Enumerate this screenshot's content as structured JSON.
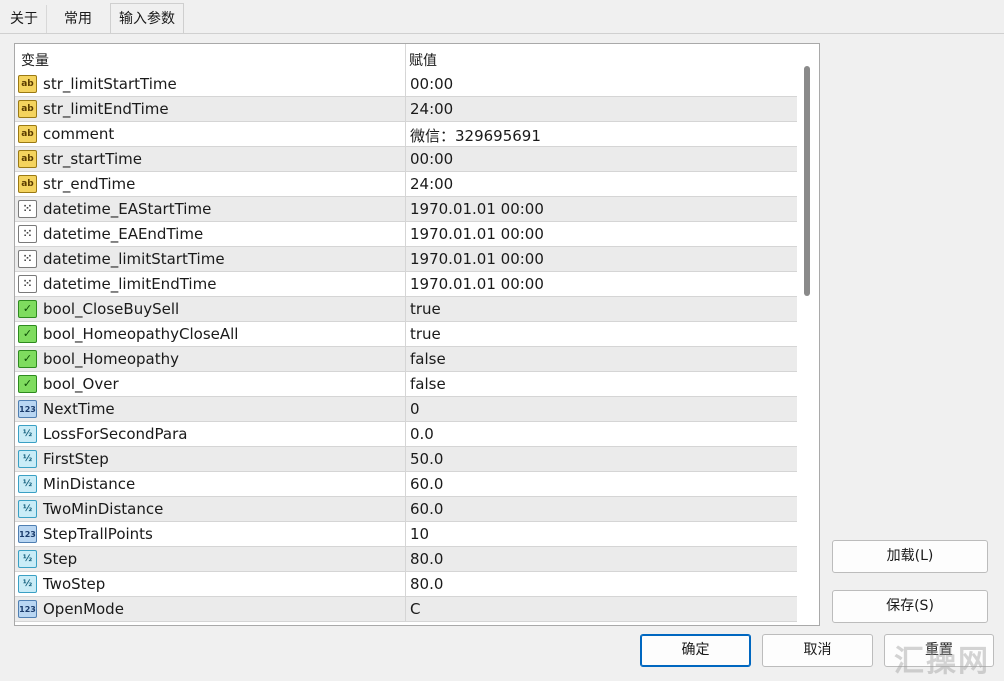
{
  "tabs": [
    {
      "label": "关于"
    },
    {
      "label": "常用"
    },
    {
      "label": "输入参数"
    }
  ],
  "grid": {
    "header": {
      "variable": "变量",
      "value": "赋值"
    },
    "rows": [
      {
        "icon": "string-icon",
        "name": "str_limitStartTime",
        "value": "00:00"
      },
      {
        "icon": "string-icon",
        "name": "str_limitEndTime",
        "value": "24:00"
      },
      {
        "icon": "string-icon",
        "name": "comment",
        "value": "微信：329695691"
      },
      {
        "icon": "string-icon",
        "name": "str_startTime",
        "value": "00:00"
      },
      {
        "icon": "string-icon",
        "name": "str_endTime",
        "value": "24:00"
      },
      {
        "icon": "datetime-icon",
        "name": "datetime_EAStartTime",
        "value": "1970.01.01 00:00"
      },
      {
        "icon": "datetime-icon",
        "name": "datetime_EAEndTime",
        "value": "1970.01.01 00:00"
      },
      {
        "icon": "datetime-icon",
        "name": "datetime_limitStartTime",
        "value": "1970.01.01 00:00"
      },
      {
        "icon": "datetime-icon",
        "name": "datetime_limitEndTime",
        "value": "1970.01.01 00:00"
      },
      {
        "icon": "bool-icon",
        "name": "bool_CloseBuySell",
        "value": "true"
      },
      {
        "icon": "bool-icon",
        "name": "bool_HomeopathyCloseAll",
        "value": "true"
      },
      {
        "icon": "bool-icon",
        "name": "bool_Homeopathy",
        "value": "false"
      },
      {
        "icon": "bool-icon",
        "name": "bool_Over",
        "value": "false"
      },
      {
        "icon": "int-icon",
        "name": "NextTime",
        "value": "0"
      },
      {
        "icon": "double-icon",
        "name": "LossForSecondPara",
        "value": "0.0"
      },
      {
        "icon": "double-icon",
        "name": "FirstStep",
        "value": "50.0"
      },
      {
        "icon": "double-icon",
        "name": "MinDistance",
        "value": "60.0"
      },
      {
        "icon": "double-icon",
        "name": "TwoMinDistance",
        "value": "60.0"
      },
      {
        "icon": "int-icon",
        "name": "StepTrallPoints",
        "value": "10"
      },
      {
        "icon": "double-icon",
        "name": "Step",
        "value": "80.0"
      },
      {
        "icon": "double-icon",
        "name": "TwoStep",
        "value": "80.0"
      },
      {
        "icon": "int-icon",
        "name": "OpenMode",
        "value": "C"
      }
    ]
  },
  "buttons": {
    "load": "加载(L)",
    "save": "保存(S)",
    "ok": "确定",
    "cancel": "取消",
    "reset": "重置"
  },
  "watermark": "汇操网"
}
